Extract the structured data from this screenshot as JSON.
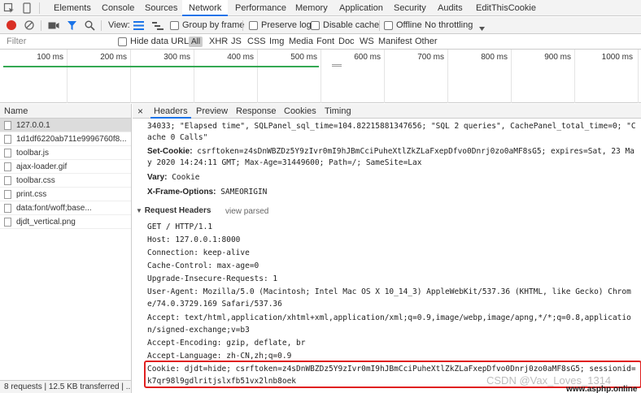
{
  "tabs": [
    "Elements",
    "Console",
    "Sources",
    "Network",
    "Performance",
    "Memory",
    "Application",
    "Security",
    "Audits",
    "EditThisCookie"
  ],
  "active_tab": "Network",
  "toolbar": {
    "view_label": "View:",
    "group_by_frame": "Group by frame",
    "preserve_log": "Preserve log",
    "disable_cache": "Disable cache",
    "offline": "Offline",
    "throttling": "No throttling"
  },
  "filter": {
    "placeholder": "Filter",
    "hide_data_urls": "Hide data URLs",
    "types": [
      "All",
      "XHR",
      "JS",
      "CSS",
      "Img",
      "Media",
      "Font",
      "Doc",
      "WS",
      "Manifest",
      "Other"
    ]
  },
  "timeline": {
    "ticks": [
      "100 ms",
      "200 ms",
      "300 ms",
      "400 ms",
      "500 ms",
      "600 ms",
      "700 ms",
      "800 ms",
      "900 ms",
      "1000 ms"
    ]
  },
  "requests": {
    "header": "Name",
    "items": [
      "127.0.0.1",
      "1d1df6220ab711e9996760f8...",
      "toolbar.js",
      "ajax-loader.gif",
      "toolbar.css",
      "print.css",
      "data:font/woff;base...",
      "djdt_vertical.png"
    ],
    "footer": "8 requests | 12.5 KB transferred | ..."
  },
  "detail_tabs": {
    "close": "×",
    "items": [
      "Headers",
      "Preview",
      "Response",
      "Cookies",
      "Timing"
    ],
    "active": "Headers"
  },
  "response_headers": {
    "cont1": "34033; \"Elapsed time\", SQLPanel_sql_time=104.82215881347656; \"SQL 2 queries\", CachePanel_total_time=0; \"C",
    "cont2": "ache 0 Calls\"",
    "set_cookie_key": "Set-Cookie:",
    "set_cookie_val1": "csrftoken=z4sDnWBZDz5Y9zIvr0mI9hJBmCciPuheXtlZkZLaFxepDfvo0Dnrj0zo0aMF8sG5; expires=Sat, 23 Ma",
    "set_cookie_val2": "y 2020 14:24:11 GMT; Max-Age=31449600; Path=/; SameSite=Lax",
    "vary_key": "Vary:",
    "vary_val": "Cookie",
    "xfo_key": "X-Frame-Options:",
    "xfo_val": "SAMEORIGIN"
  },
  "request_headers": {
    "title": "Request Headers",
    "view_parsed": "view parsed",
    "lines": [
      "GET / HTTP/1.1",
      "Host: 127.0.0.1:8000",
      "Connection: keep-alive",
      "Cache-Control: max-age=0",
      "Upgrade-Insecure-Requests: 1",
      "User-Agent: Mozilla/5.0 (Macintosh; Intel Mac OS X 10_14_3) AppleWebKit/537.36 (KHTML, like Gecko) Chrom",
      "e/74.0.3729.169 Safari/537.36",
      "Accept: text/html,application/xhtml+xml,application/xml;q=0.9,image/webp,image/apng,*/*;q=0.8,applicatio",
      "n/signed-exchange;v=b3",
      "Accept-Encoding: gzip, deflate, br",
      "Accept-Language: zh-CN,zh;q=0.9",
      "Cookie: djdt=hide; csrftoken=z4sDnWBZDz5Y9zIvr0mI9hJBmCciPuheXtlZkZLaFxepDfvo0Dnrj0zo0aMF8sG5; sessionid=",
      "k7qr98l9gdlritjslxfb51vx2lnb8oek"
    ]
  },
  "watermark": {
    "csdn": "CSDN @Vax_Loves_1314",
    "site": "www.asphp.online"
  },
  "colors": {
    "accent": "#1a73e8",
    "record": "#d93025",
    "highlight_box": "#e02020"
  }
}
